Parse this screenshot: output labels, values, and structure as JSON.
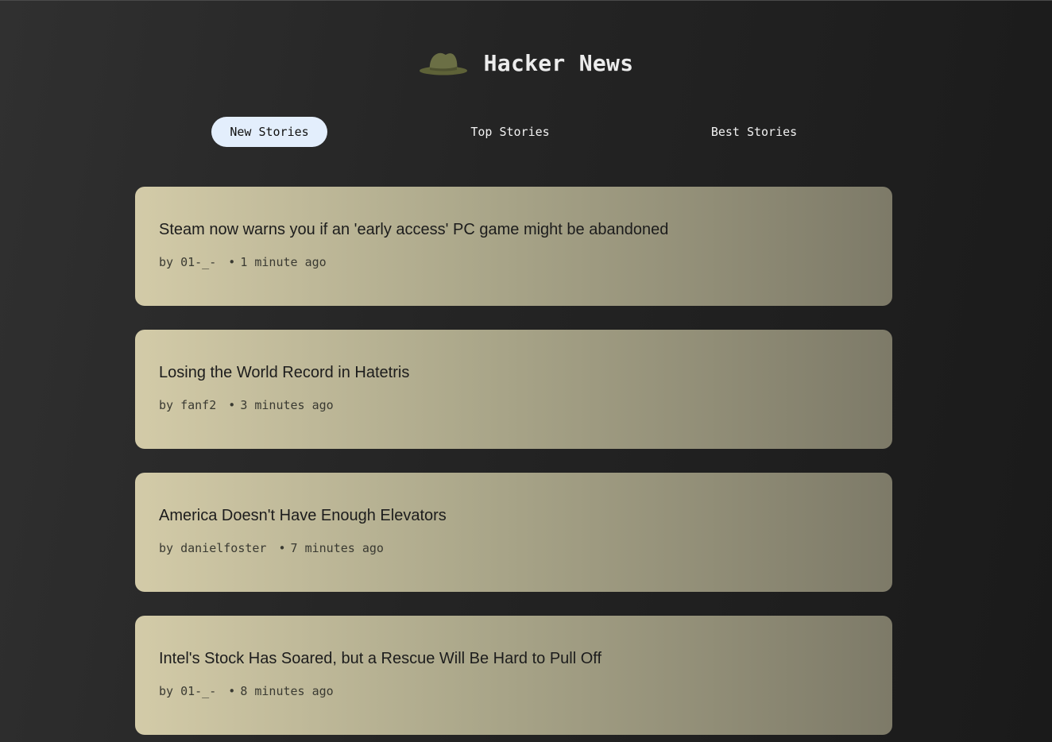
{
  "header": {
    "title": "Hacker News",
    "logo_icon": "hat-icon",
    "logo_color": "#6b6f45"
  },
  "tabs": [
    {
      "label": "New Stories",
      "active": true
    },
    {
      "label": "Top Stories",
      "active": false
    },
    {
      "label": "Best Stories",
      "active": false
    }
  ],
  "colors": {
    "active_tab_bg": "#e3eefc",
    "card_gradient_start": "#d3cba8",
    "card_gradient_end": "#7d7a68",
    "page_bg": "#242424"
  },
  "stories": [
    {
      "title": "Steam now warns you if an 'early access' PC game might be abandoned",
      "by_prefix": "by",
      "author": "01-_-",
      "separator": "•",
      "time": "1 minute ago"
    },
    {
      "title": "Losing the World Record in Hatetris",
      "by_prefix": "by",
      "author": "fanf2",
      "separator": "•",
      "time": "3 minutes ago"
    },
    {
      "title": "America Doesn't Have Enough Elevators",
      "by_prefix": "by",
      "author": "danielfoster",
      "separator": "•",
      "time": "7 minutes ago"
    },
    {
      "title": "Intel's Stock Has Soared, but a Rescue Will Be Hard to Pull Off",
      "by_prefix": "by",
      "author": "01-_-",
      "separator": "•",
      "time": "8 minutes ago"
    }
  ]
}
